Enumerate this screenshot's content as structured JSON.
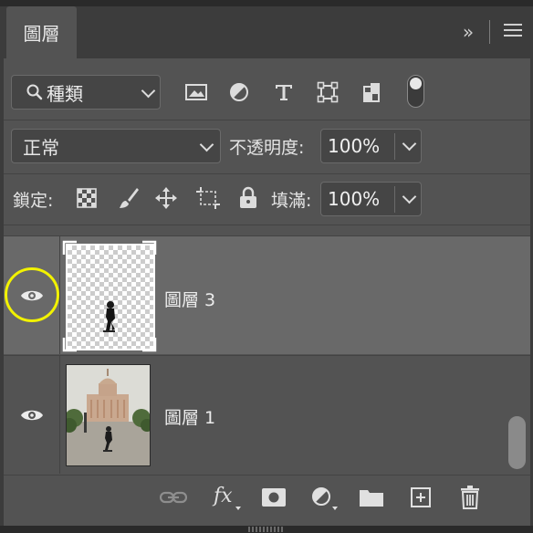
{
  "panel": {
    "tab_label": "圖層",
    "collapse_glyph": "»"
  },
  "filter": {
    "kind_label": "種類",
    "toggle_on": true
  },
  "blend": {
    "mode": "正常",
    "opacity_label": "不透明度:",
    "opacity_value": "100%"
  },
  "lock": {
    "label": "鎖定:",
    "fill_label": "填滿:",
    "fill_value": "100%"
  },
  "layers": [
    {
      "name": "圖層 3",
      "visible": true,
      "selected": true,
      "thumbnail": "transparent-skateboarder-cutout"
    },
    {
      "name": "圖層 1",
      "visible": true,
      "selected": false,
      "thumbnail": "capitol-building-photo"
    }
  ],
  "footer_icons": [
    "link-layers-icon",
    "fx-icon",
    "add-mask-icon",
    "adjustment-layer-icon",
    "new-group-icon",
    "new-layer-icon",
    "delete-icon"
  ],
  "colors": {
    "highlight_ring": "#f2f200",
    "selected_row": "#696969",
    "panel_bg": "#535353"
  }
}
